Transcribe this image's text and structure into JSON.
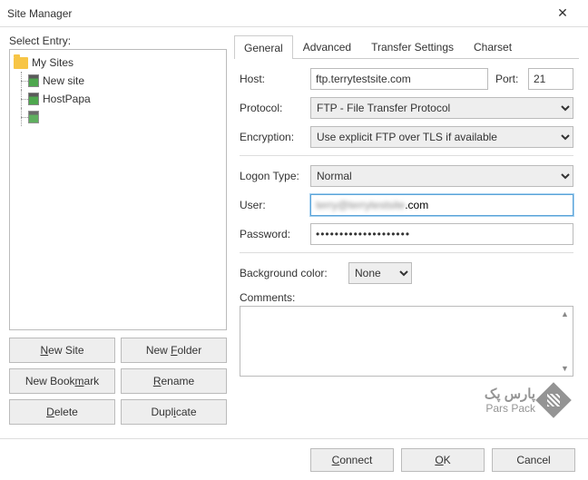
{
  "window": {
    "title": "Site Manager"
  },
  "left": {
    "select_label": "Select Entry:",
    "root": "My Sites",
    "sites": [
      "New site",
      "HostPapa"
    ],
    "buttons": {
      "new_site": "New Site",
      "new_site_u": "N",
      "new_folder": "New Folder",
      "new_folder_u": "F",
      "new_bookmark": "New Bookmark",
      "new_bookmark_u": "m",
      "rename": "Rename",
      "rename_u": "R",
      "delete": "Delete",
      "delete_u": "D",
      "duplicate": "Duplicate",
      "duplicate_u": "i"
    }
  },
  "tabs": [
    "General",
    "Advanced",
    "Transfer Settings",
    "Charset"
  ],
  "form": {
    "host_label": "Host:",
    "host_value": "ftp.terrytestsite.com",
    "port_label": "Port:",
    "port_value": "21",
    "protocol_label": "Protocol:",
    "protocol_value": "FTP - File Transfer Protocol",
    "encryption_label": "Encryption:",
    "encryption_value": "Use explicit FTP over TLS if available",
    "logon_label": "Logon Type:",
    "logon_value": "Normal",
    "user_label": "User:",
    "user_value_vis": ".com",
    "password_label": "Password:",
    "password_value": "••••••••••••••••••••",
    "bg_label": "Background color:",
    "bg_value": "None",
    "comments_label": "Comments:",
    "comments_value": ""
  },
  "footer": {
    "connect": "Connect",
    "connect_u": "C",
    "ok": "OK",
    "ok_u": "O",
    "cancel": "Cancel"
  },
  "watermark": {
    "line1": "پارس پک",
    "line2": "Pars Pack"
  }
}
